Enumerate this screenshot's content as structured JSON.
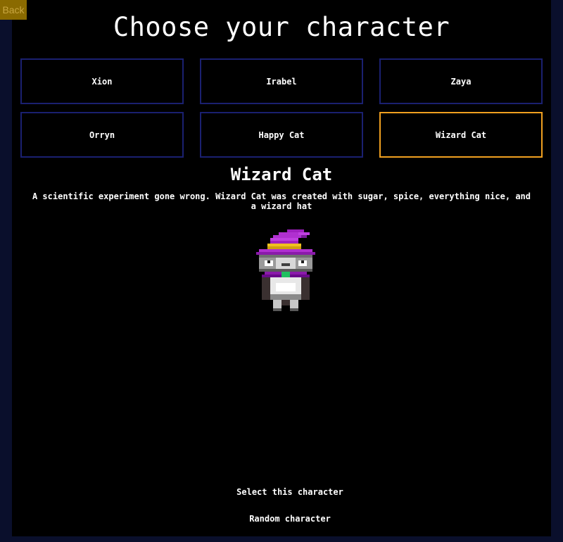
{
  "back_label": "Back",
  "title": "Choose your character",
  "characters": [
    {
      "name": "Xion"
    },
    {
      "name": "Irabel"
    },
    {
      "name": "Zaya"
    },
    {
      "name": "Orryn"
    },
    {
      "name": "Happy Cat"
    },
    {
      "name": "Wizard Cat"
    }
  ],
  "selected": {
    "name": "Wizard Cat",
    "description": "A scientific experiment gone wrong. Wizard Cat was created with sugar, spice, everything nice, and a wizard hat",
    "sprite_icon": "wizard-cat-sprite"
  },
  "actions": {
    "select_label": "Select this character",
    "random_label": "Random character"
  },
  "colors": {
    "background": "#000000",
    "outer_background": "#0a0f2c",
    "card_border": "#1a2070",
    "selected_border": "#f0a020",
    "back_button": "#8a6a00"
  }
}
